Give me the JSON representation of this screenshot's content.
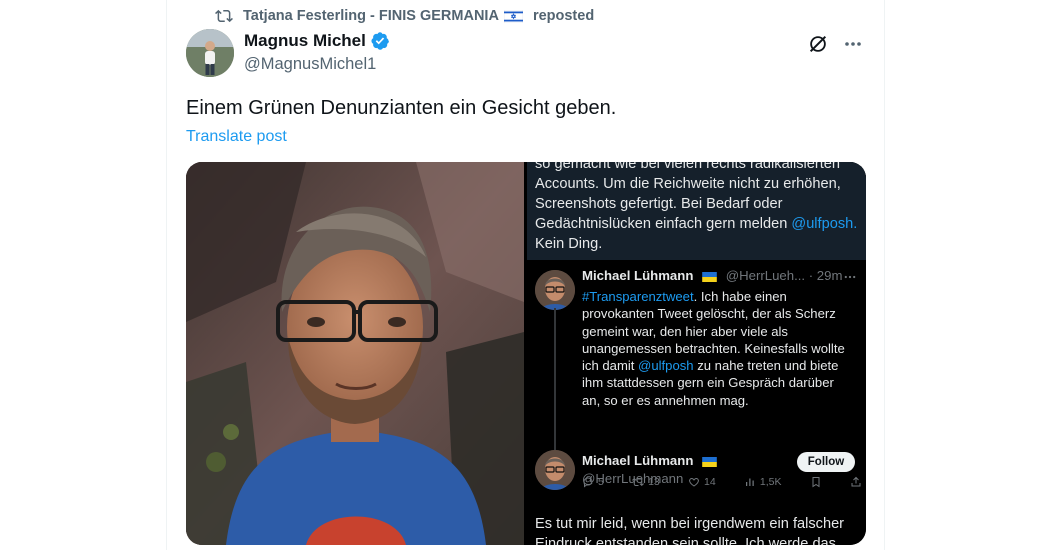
{
  "repost": {
    "icon": "repost-icon",
    "user": "Tatjana Festerling - FINIS GERMANIA",
    "flag": "israel-flag",
    "label": "reposted"
  },
  "post": {
    "author_name": "Magnus Michel",
    "verified": true,
    "author_handle": "@MagnusMichel1",
    "text": "Einem Grünen Denunzianten ein Gesicht geben.",
    "translate_label": "Translate post"
  },
  "screenshot": {
    "top_lines": [
      "so gemacht wie bei vielen rechts radikalisierten",
      "Accounts. Um die Reichweite nicht zu erhöhen,",
      "Screenshots gefertigt. Bei Bedarf oder",
      "Gedächtnislücken einfach gern melden",
      "Kein Ding."
    ],
    "top_mention": "@ulfposh.",
    "reply1": {
      "name": "Michael Lühmann",
      "handle_time": "@HerrLueh... · 29m",
      "hashtag": "#Transparenztweet",
      "lines": [
        ". Ich habe einen",
        "provokanten Tweet gelöscht, der als Scherz",
        "gemeint war, den hier aber viele als",
        "unangemessen betrachten. Keinesfalls wollte",
        "ich damit",
        " zu nahe treten und biete",
        "ihm stattdessen gern ein Gespräch darüber",
        "an, so er es annehmen mag."
      ],
      "mention": "@ulfposh",
      "actions": {
        "replies": "5",
        "reposts": "13",
        "likes": "14",
        "views": "1,5K"
      }
    },
    "reply2": {
      "name": "Michael Lühmann",
      "handle": "@HerrLuehmann",
      "follow_label": "Follow"
    },
    "bottom_lines": [
      "Es tut mir leid, wenn bei irgendwem ein falscher",
      "Eindruck entstanden sein sollte. Ich werde das"
    ]
  },
  "colors": {
    "accent": "#1d9bf0",
    "text": "#0f1419",
    "secondary": "#536471"
  }
}
